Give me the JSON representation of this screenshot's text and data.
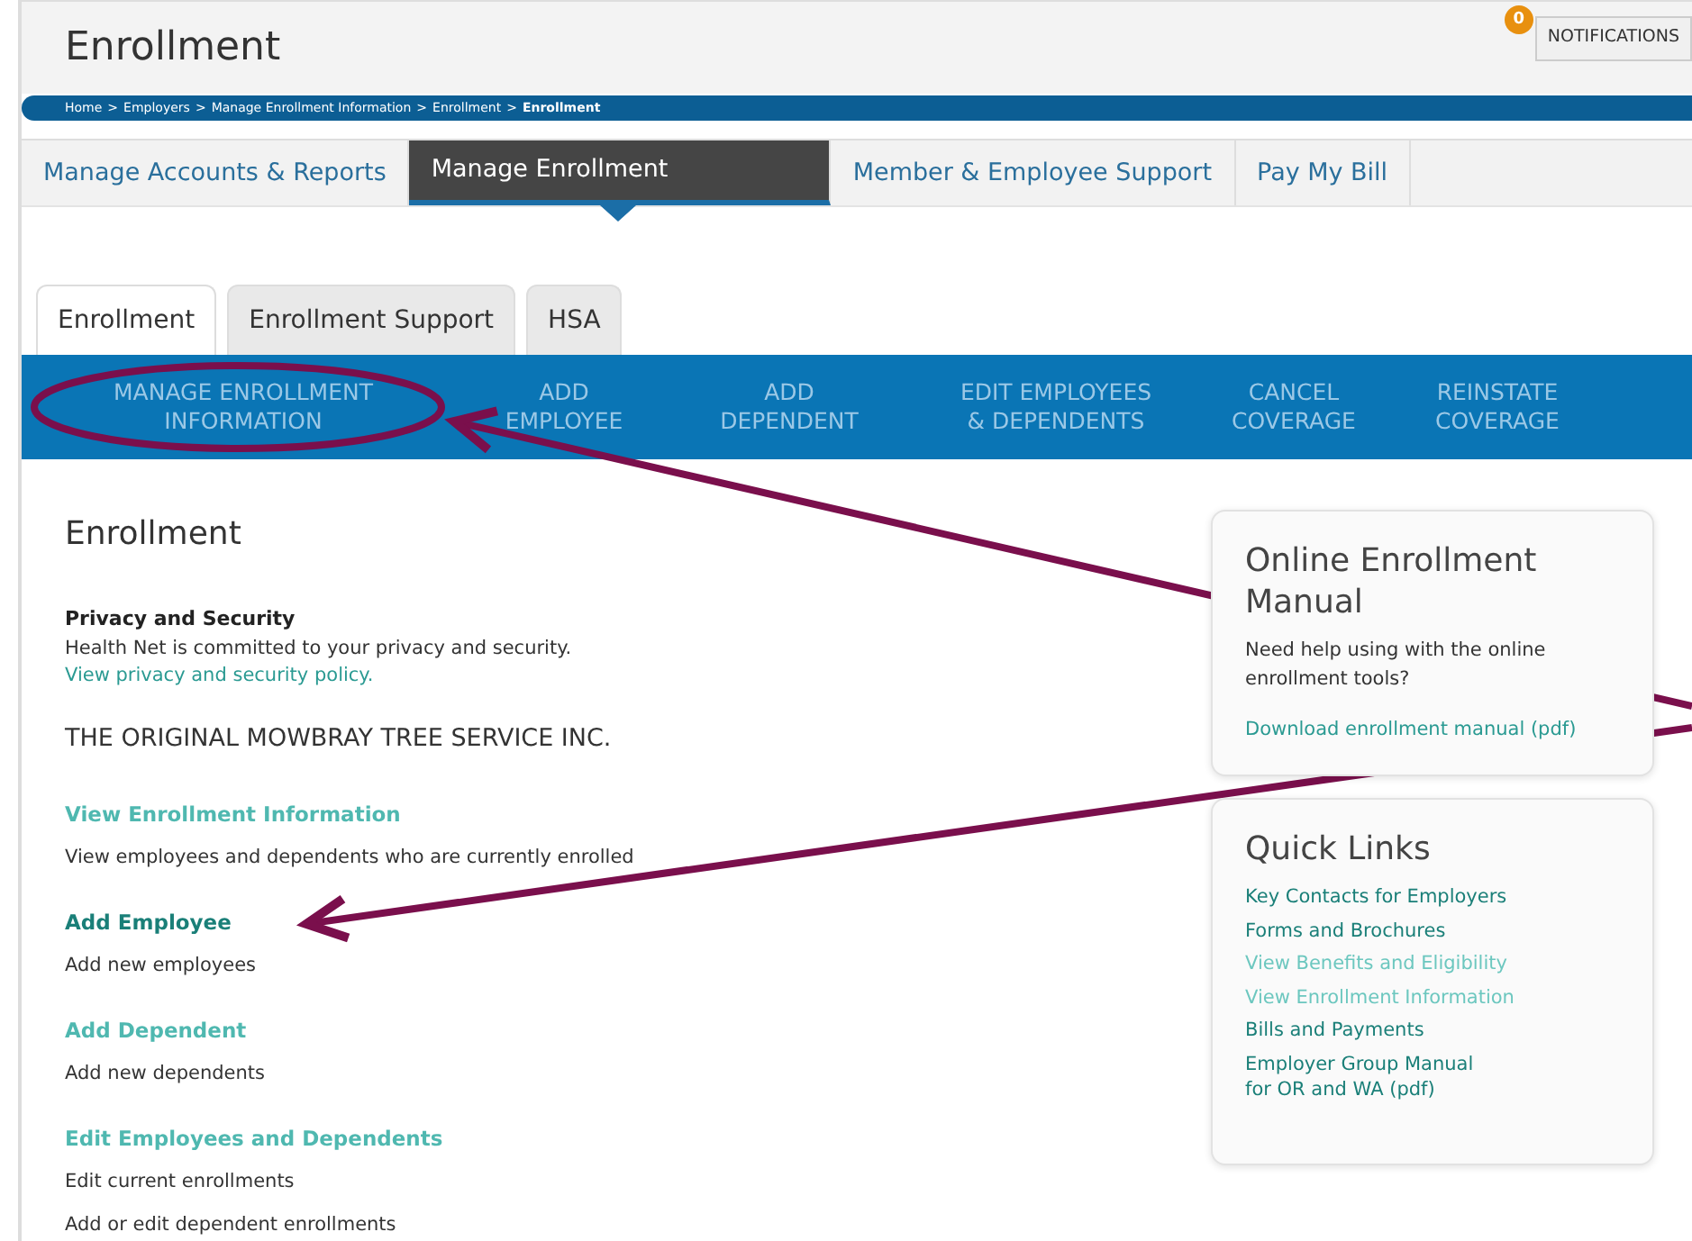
{
  "header": {
    "title": "Enrollment",
    "notifications": {
      "count": "0",
      "label": "NOTIFICATIONS"
    }
  },
  "breadcrumb": {
    "separator": ">",
    "items": [
      {
        "label": "Home",
        "current": false
      },
      {
        "label": "Employers",
        "current": false
      },
      {
        "label": "Manage Enrollment Information",
        "current": false
      },
      {
        "label": "Enrollment",
        "current": false
      },
      {
        "label": "Enrollment",
        "current": true
      }
    ]
  },
  "main_nav": [
    {
      "label": "Manage Accounts & Reports",
      "selected": false
    },
    {
      "label": "Manage Enrollment",
      "selected": true
    },
    {
      "label": "Member & Employee Support",
      "selected": false
    },
    {
      "label": "Pay My Bill",
      "selected": false
    }
  ],
  "tabs": [
    {
      "label": "Enrollment",
      "selected": true
    },
    {
      "label": "Enrollment Support",
      "selected": false
    },
    {
      "label": "HSA",
      "selected": false
    }
  ],
  "sub_nav": [
    {
      "lines": [
        "MANAGE ENROLLMENT",
        "INFORMATION"
      ]
    },
    {
      "lines": [
        "ADD",
        "EMPLOYEE"
      ]
    },
    {
      "lines": [
        "ADD",
        "DEPENDENT"
      ]
    },
    {
      "lines": [
        "EDIT EMPLOYEES",
        "& DEPENDENTS"
      ]
    },
    {
      "lines": [
        "CANCEL",
        "COVERAGE"
      ]
    },
    {
      "lines": [
        "REINSTATE",
        "COVERAGE"
      ]
    }
  ],
  "content": {
    "title": "Enrollment",
    "privacy": {
      "heading": "Privacy and Security",
      "text": "Health Net is committed to your privacy and security.",
      "link": "View privacy and security policy."
    },
    "company": "THE ORIGINAL MOWBRAY TREE SERVICE INC.",
    "sections": [
      {
        "link": "View Enrollment Information",
        "color": "#4fb8b0",
        "bullets": [
          "View employees and dependents who are currently enrolled"
        ]
      },
      {
        "link": "Add Employee",
        "color": "#1a7f78",
        "bullets": [
          "Add new employees"
        ]
      },
      {
        "link": "Add Dependent",
        "color": "#4fb8b0",
        "bullets": [
          "Add new dependents"
        ]
      },
      {
        "link": "Edit Employees and Dependents",
        "color": "#4fb8b0",
        "bullets": [
          "Edit current enrollments",
          "Add or edit dependent enrollments"
        ]
      }
    ]
  },
  "sidebar": [
    {
      "title": "Online Enrollment Manual",
      "text": "Need help using with the online enrollment tools?",
      "links": [
        {
          "label": "Download enrollment manual (pdf)",
          "color": "#2a9a92"
        }
      ]
    },
    {
      "title": "Quick Links",
      "links": [
        {
          "label": "Key Contacts for Employers",
          "color": "#1a7f78"
        },
        {
          "label": "Forms and Brochures",
          "color": "#1a7f78"
        },
        {
          "label": "View Benefits and Eligibility",
          "color": "#6cc7bf"
        },
        {
          "label": "View Enrollment Information",
          "color": "#6cc7bf"
        },
        {
          "label": "Bills and Payments",
          "color": "#1a7f78"
        },
        {
          "label": "Employer Group Manual\nfor OR and WA (pdf)",
          "color": "#1a7f78"
        }
      ]
    }
  ],
  "annotation": {
    "ellipse": true,
    "arrows": true
  }
}
